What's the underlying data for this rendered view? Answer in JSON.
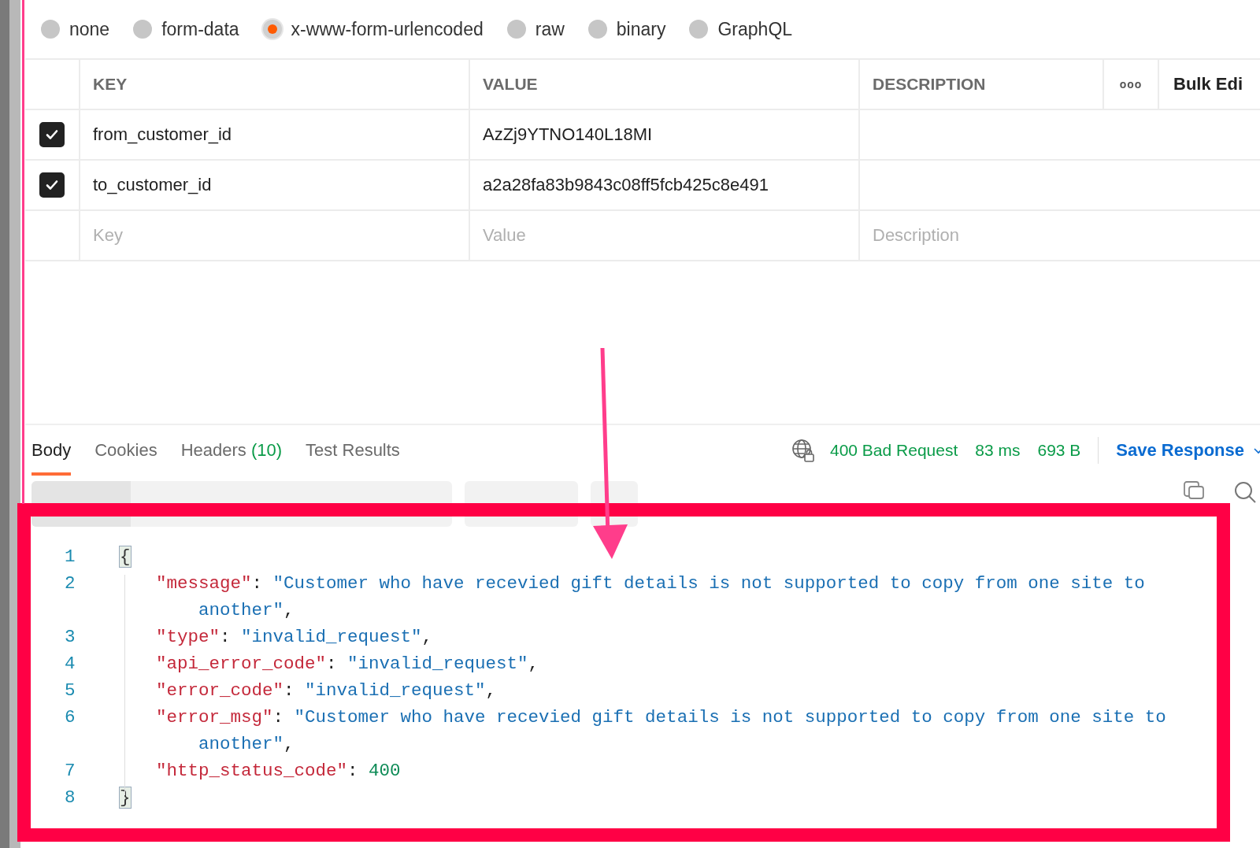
{
  "body_types": [
    {
      "label": "none",
      "selected": false
    },
    {
      "label": "form-data",
      "selected": false
    },
    {
      "label": "x-www-form-urlencoded",
      "selected": true
    },
    {
      "label": "raw",
      "selected": false
    },
    {
      "label": "binary",
      "selected": false
    },
    {
      "label": "GraphQL",
      "selected": false
    }
  ],
  "params_table": {
    "columns": [
      "KEY",
      "VALUE",
      "DESCRIPTION"
    ],
    "more": "ooo",
    "bulk_edit": "Bulk Edi",
    "rows": [
      {
        "checked": true,
        "key": "from_customer_id",
        "value": "AzZj9YTNO140L18MI",
        "description": ""
      },
      {
        "checked": true,
        "key": "to_customer_id",
        "value": "a2a28fa83b9843c08ff5fcb425c8e491",
        "description": ""
      }
    ],
    "new_row": {
      "key": {
        "placeholder": "Key"
      },
      "value": {
        "placeholder": "Value"
      },
      "description": {
        "placeholder": "Description"
      }
    }
  },
  "response_tabs": [
    {
      "label": "Body",
      "selected": true
    },
    {
      "label": "Cookies",
      "selected": false
    },
    {
      "label": "Headers",
      "count": "(10)",
      "selected": false
    },
    {
      "label": "Test Results",
      "selected": false
    }
  ],
  "status": {
    "code": "400 Bad Request",
    "time": "83 ms",
    "size": "693 B"
  },
  "save_response": "Save Response",
  "code_lines": [
    {
      "number": "1",
      "tokens": [
        {
          "kind": "brace",
          "text": "{"
        }
      ]
    },
    {
      "number": "2",
      "tokens": [
        {
          "kind": "key",
          "text": "\"message\""
        },
        {
          "kind": "punct",
          "text": ": "
        },
        {
          "kind": "string",
          "text": "\"Customer who have recevied gift details is not supported to copy from one site to"
        }
      ],
      "continuation": [
        {
          "kind": "string",
          "text": "another\""
        },
        {
          "kind": "punct",
          "text": ","
        }
      ]
    },
    {
      "number": "3",
      "tokens": [
        {
          "kind": "key",
          "text": "\"type\""
        },
        {
          "kind": "punct",
          "text": ": "
        },
        {
          "kind": "string",
          "text": "\"invalid_request\""
        },
        {
          "kind": "punct",
          "text": ","
        }
      ]
    },
    {
      "number": "4",
      "tokens": [
        {
          "kind": "key",
          "text": "\"api_error_code\""
        },
        {
          "kind": "punct",
          "text": ": "
        },
        {
          "kind": "string",
          "text": "\"invalid_request\""
        },
        {
          "kind": "punct",
          "text": ","
        }
      ]
    },
    {
      "number": "5",
      "tokens": [
        {
          "kind": "key",
          "text": "\"error_code\""
        },
        {
          "kind": "punct",
          "text": ": "
        },
        {
          "kind": "string",
          "text": "\"invalid_request\""
        },
        {
          "kind": "punct",
          "text": ","
        }
      ]
    },
    {
      "number": "6",
      "tokens": [
        {
          "kind": "key",
          "text": "\"error_msg\""
        },
        {
          "kind": "punct",
          "text": ": "
        },
        {
          "kind": "string",
          "text": "\"Customer who have recevied gift details is not supported to copy from one site to"
        }
      ],
      "continuation": [
        {
          "kind": "string",
          "text": "another\""
        },
        {
          "kind": "punct",
          "text": ","
        }
      ]
    },
    {
      "number": "7",
      "tokens": [
        {
          "kind": "key",
          "text": "\"http_status_code\""
        },
        {
          "kind": "punct",
          "text": ": "
        },
        {
          "kind": "number",
          "text": "400"
        }
      ]
    },
    {
      "number": "8",
      "tokens": [
        {
          "kind": "brace",
          "text": "}"
        }
      ]
    }
  ]
}
